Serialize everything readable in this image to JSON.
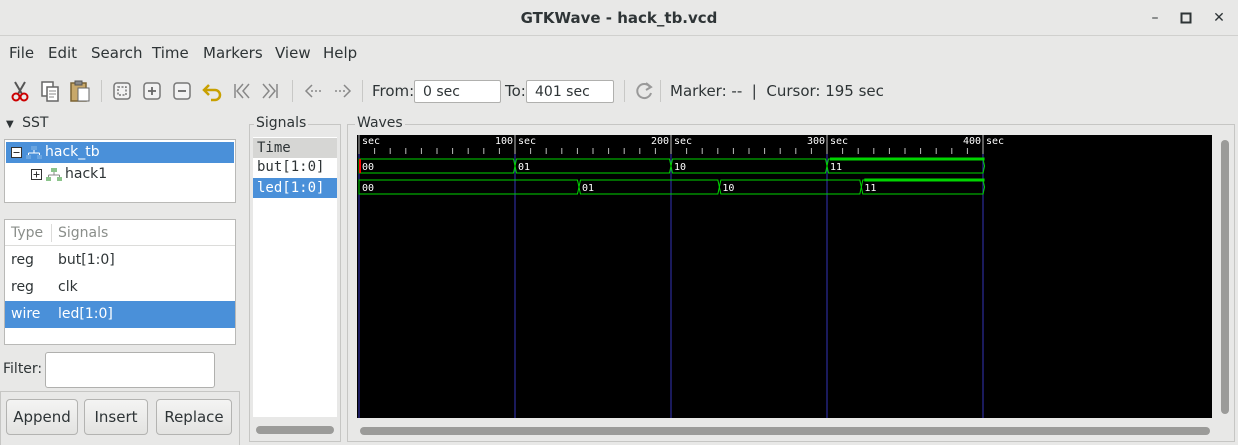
{
  "window": {
    "title": "GTKWave - hack_tb.vcd"
  },
  "menu": [
    "File",
    "Edit",
    "Search",
    "Time",
    "Markers",
    "View",
    "Help"
  ],
  "toolbar": {
    "from_label": "From:",
    "from_value": "0 sec",
    "to_label": "To:",
    "to_value": "401 sec",
    "marker_text": "Marker: --  |  Cursor: 195 sec"
  },
  "sst": {
    "header": "SST",
    "tree": [
      {
        "label": "hack_tb",
        "selected": true
      },
      {
        "label": "hack1",
        "selected": false
      }
    ],
    "columns": [
      "Type",
      "Signals"
    ],
    "rows": [
      {
        "type": "reg",
        "signal": "but[1:0]",
        "selected": false
      },
      {
        "type": "reg",
        "signal": "clk",
        "selected": false
      },
      {
        "type": "wire",
        "signal": "led[1:0]",
        "selected": true
      }
    ],
    "filter_label": "Filter:",
    "buttons": [
      "Append",
      "Insert",
      "Replace"
    ]
  },
  "signals": {
    "title": "Signals",
    "rows": [
      {
        "label": "Time",
        "kind": "header"
      },
      {
        "label": "but[1:0]",
        "kind": "normal"
      },
      {
        "label": "led[1:0]",
        "kind": "selected"
      }
    ]
  },
  "waves": {
    "title": "Waves",
    "time_range": [
      0,
      401
    ],
    "unit": "sec",
    "tick_labels": [
      "0",
      "100",
      "200",
      "300",
      "400"
    ],
    "major_ticks": [
      0,
      100,
      200,
      300,
      400
    ],
    "cursor_time": 195,
    "traces": [
      {
        "name": "but[1:0]",
        "segments": [
          {
            "start": 0,
            "end": 100,
            "value": "00"
          },
          {
            "start": 100,
            "end": 200,
            "value": "01"
          },
          {
            "start": 200,
            "end": 300,
            "value": "10"
          },
          {
            "start": 300,
            "end": 401,
            "value": "11"
          }
        ]
      },
      {
        "name": "led[1:0]",
        "segments": [
          {
            "start": 0,
            "end": 141,
            "value": "00"
          },
          {
            "start": 141,
            "end": 231,
            "value": "01"
          },
          {
            "start": 231,
            "end": 322,
            "value": "10"
          },
          {
            "start": 322,
            "end": 401,
            "value": "11"
          }
        ]
      }
    ],
    "colors": {
      "background": "#000000",
      "trace": "#00d400",
      "grid": "#3434b8",
      "text": "#ffffff",
      "marker": "#ff0000"
    }
  }
}
